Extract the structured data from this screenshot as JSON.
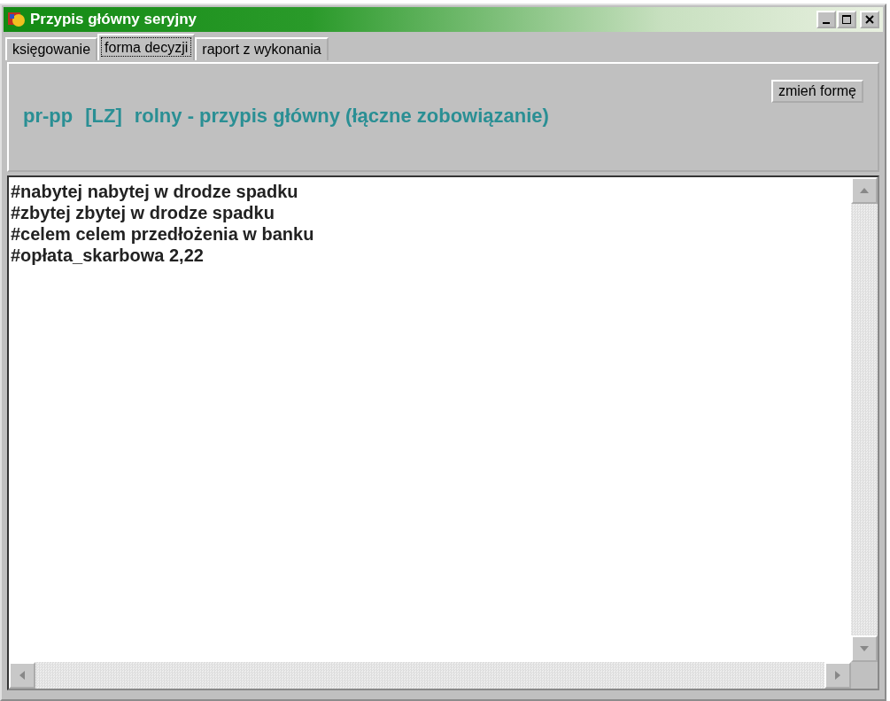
{
  "window": {
    "title": "Przypis główny seryjny"
  },
  "tabs": [
    {
      "label": "księgowanie",
      "selected": false
    },
    {
      "label": "forma decyzji",
      "selected": true
    },
    {
      "label": "raport z wykonania",
      "selected": false
    }
  ],
  "panel": {
    "button": "zmień formę",
    "heading": [
      "pr-pp",
      "[LZ]",
      "rolny - przypis główny (łączne zobowiązanie)"
    ]
  },
  "editor": {
    "lines": [
      "#nabytej nabytej w drodze spadku",
      "#zbytej zbytej w drodze spadku",
      "#celem celem przedłożenia w banku",
      "#opłata_skarbowa 2,22"
    ]
  }
}
